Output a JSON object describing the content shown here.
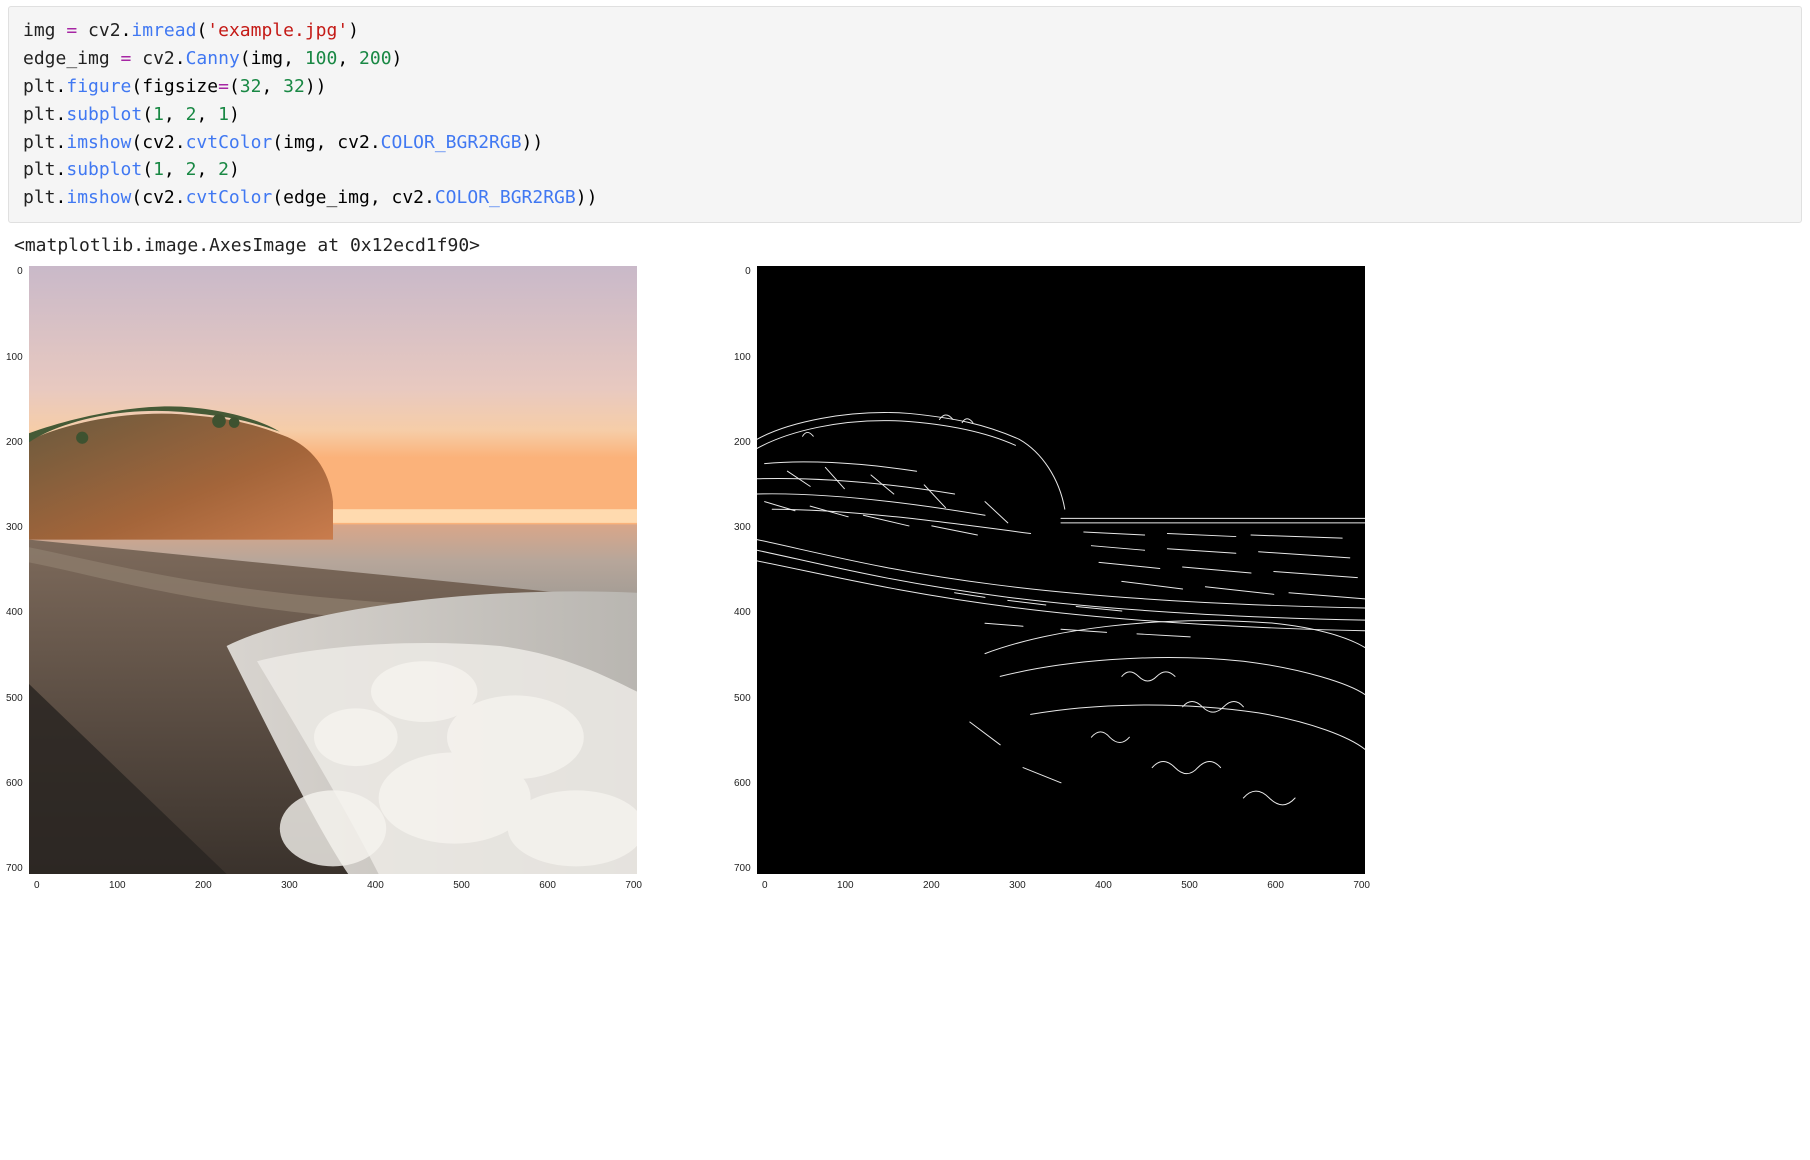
{
  "code": {
    "lines": [
      {
        "raw": "img = cv2.imread('example.jpg')",
        "tokens": [
          {
            "t": "img ",
            "c": "var"
          },
          {
            "t": "=",
            "c": "assign"
          },
          {
            "t": " cv2",
            "c": "var"
          },
          {
            "t": ".",
            "c": ""
          },
          {
            "t": "imread",
            "c": "fn"
          },
          {
            "t": "(",
            "c": ""
          },
          {
            "t": "'example.jpg'",
            "c": "str"
          },
          {
            "t": ")",
            "c": ""
          }
        ]
      },
      {
        "raw": "edge_img = cv2.Canny(img, 100, 200)",
        "tokens": [
          {
            "t": "edge_img ",
            "c": "var"
          },
          {
            "t": "=",
            "c": "assign"
          },
          {
            "t": " cv2",
            "c": "var"
          },
          {
            "t": ".",
            "c": ""
          },
          {
            "t": "Canny",
            "c": "fn"
          },
          {
            "t": "(img, ",
            "c": ""
          },
          {
            "t": "100",
            "c": "num"
          },
          {
            "t": ", ",
            "c": ""
          },
          {
            "t": "200",
            "c": "num"
          },
          {
            "t": ")",
            "c": ""
          }
        ]
      },
      {
        "raw": "plt.figure(figsize=(32, 32))",
        "tokens": [
          {
            "t": "plt",
            "c": "var"
          },
          {
            "t": ".",
            "c": ""
          },
          {
            "t": "figure",
            "c": "fn"
          },
          {
            "t": "(figsize",
            "c": ""
          },
          {
            "t": "=",
            "c": "assign"
          },
          {
            "t": "(",
            "c": ""
          },
          {
            "t": "32",
            "c": "num"
          },
          {
            "t": ", ",
            "c": ""
          },
          {
            "t": "32",
            "c": "num"
          },
          {
            "t": "))",
            "c": ""
          }
        ]
      },
      {
        "raw": "plt.subplot(1, 2, 1)",
        "tokens": [
          {
            "t": "plt",
            "c": "var"
          },
          {
            "t": ".",
            "c": ""
          },
          {
            "t": "subplot",
            "c": "fn"
          },
          {
            "t": "(",
            "c": ""
          },
          {
            "t": "1",
            "c": "num"
          },
          {
            "t": ", ",
            "c": ""
          },
          {
            "t": "2",
            "c": "num"
          },
          {
            "t": ", ",
            "c": ""
          },
          {
            "t": "1",
            "c": "num"
          },
          {
            "t": ")",
            "c": ""
          }
        ]
      },
      {
        "raw": "plt.imshow(cv2.cvtColor(img, cv2.COLOR_BGR2RGB))",
        "tokens": [
          {
            "t": "plt",
            "c": "var"
          },
          {
            "t": ".",
            "c": ""
          },
          {
            "t": "imshow",
            "c": "fn"
          },
          {
            "t": "(cv2",
            "c": ""
          },
          {
            "t": ".",
            "c": ""
          },
          {
            "t": "cvtColor",
            "c": "fn"
          },
          {
            "t": "(img, cv2",
            "c": ""
          },
          {
            "t": ".",
            "c": ""
          },
          {
            "t": "COLOR_BGR2RGB",
            "c": "attr"
          },
          {
            "t": "))",
            "c": ""
          }
        ]
      },
      {
        "raw": "plt.subplot(1, 2, 2)",
        "tokens": [
          {
            "t": "plt",
            "c": "var"
          },
          {
            "t": ".",
            "c": ""
          },
          {
            "t": "subplot",
            "c": "fn"
          },
          {
            "t": "(",
            "c": ""
          },
          {
            "t": "1",
            "c": "num"
          },
          {
            "t": ", ",
            "c": ""
          },
          {
            "t": "2",
            "c": "num"
          },
          {
            "t": ", ",
            "c": ""
          },
          {
            "t": "2",
            "c": "num"
          },
          {
            "t": ")",
            "c": ""
          }
        ]
      },
      {
        "raw": "plt.imshow(cv2.cvtColor(edge_img, cv2.COLOR_BGR2RGB))",
        "tokens": [
          {
            "t": "plt",
            "c": "var"
          },
          {
            "t": ".",
            "c": ""
          },
          {
            "t": "imshow",
            "c": "fn"
          },
          {
            "t": "(cv2",
            "c": ""
          },
          {
            "t": ".",
            "c": ""
          },
          {
            "t": "cvtColor",
            "c": "fn"
          },
          {
            "t": "(edge_img, cv2",
            "c": ""
          },
          {
            "t": ".",
            "c": ""
          },
          {
            "t": "COLOR_BGR2RGB",
            "c": "attr"
          },
          {
            "t": "))",
            "c": ""
          }
        ]
      }
    ]
  },
  "output_repr": "<matplotlib.image.AxesImage at 0x12ecd1f90>",
  "chart_data": [
    {
      "type": "image",
      "title": "",
      "description": "Original RGB photo: beach at sunset, cliff/headland on left, ocean and foam waves in foreground, pink-orange sky.",
      "xticks": [
        "0",
        "100",
        "200",
        "300",
        "400",
        "500",
        "600",
        "700"
      ],
      "yticks": [
        "0",
        "100",
        "200",
        "300",
        "400",
        "500",
        "600",
        "700"
      ],
      "xlim": [
        0,
        800
      ],
      "ylim": [
        800,
        0
      ]
    },
    {
      "type": "image",
      "title": "",
      "description": "Canny edge-detected version of the same photo: white edge lines on black; cliff outline, horizon, wave foam textures visible.",
      "xticks": [
        "0",
        "100",
        "200",
        "300",
        "400",
        "500",
        "600",
        "700"
      ],
      "yticks": [
        "0",
        "100",
        "200",
        "300",
        "400",
        "500",
        "600",
        "700"
      ],
      "xlim": [
        0,
        800
      ],
      "ylim": [
        800,
        0
      ]
    }
  ]
}
